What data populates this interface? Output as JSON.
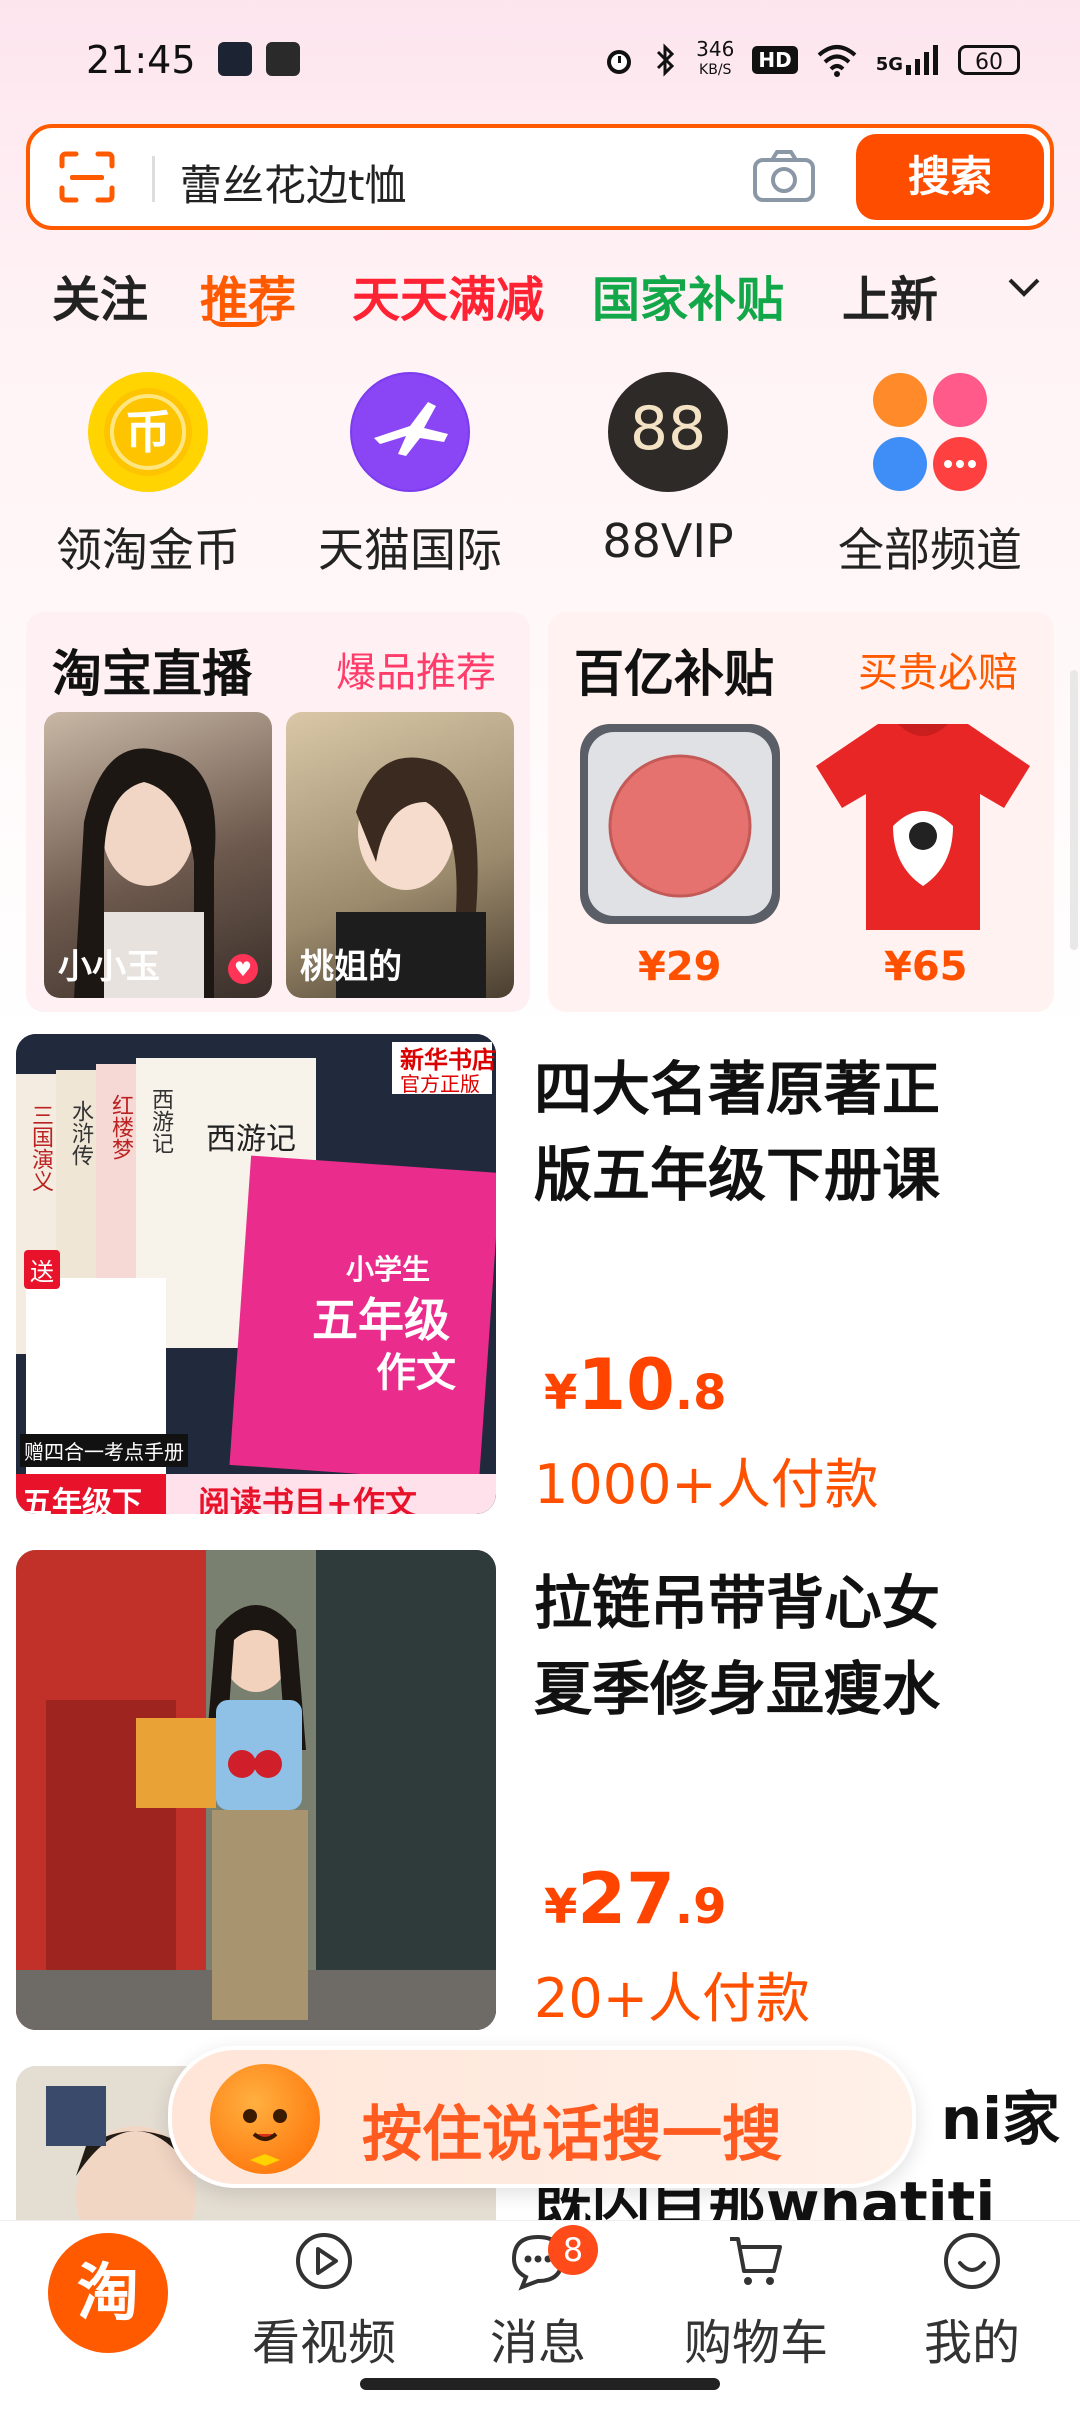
{
  "status_bar": {
    "time": "21:45",
    "net_speed_top": "346",
    "net_speed_bottom": "KB/S",
    "hd": "HD",
    "signal": "5G",
    "battery": "60"
  },
  "search": {
    "query": "蕾丝花边t恤",
    "button": "搜索"
  },
  "tabs": [
    "关注",
    "推荐",
    "天天满减",
    "国家补贴",
    "上新"
  ],
  "channels": [
    {
      "label": "领淘金币",
      "icon": "coin-icon"
    },
    {
      "label": "天猫国际",
      "icon": "plane-globe-icon"
    },
    {
      "label": "88VIP",
      "icon_text": "88",
      "icon": "vip-icon"
    },
    {
      "label": "全部频道",
      "icon": "channels-grid-icon"
    }
  ],
  "live_card": {
    "title": "淘宝直播",
    "subtitle": "爆品推荐",
    "streams": [
      {
        "name": "小小玉"
      },
      {
        "name": "桃姐的"
      }
    ]
  },
  "subsidy_card": {
    "title": "百亿补贴",
    "subtitle": "买贵必赔",
    "items": [
      {
        "price": "¥29"
      },
      {
        "price": "¥65"
      }
    ]
  },
  "products": [
    {
      "title_line1": "四大名著原著正",
      "title_line2": "版五年级下册课",
      "price_symbol": "¥",
      "price_int": "10",
      "price_dec": ".8",
      "sales": "1000+人付款",
      "image_text": {
        "book1": "三国演义",
        "book2": "水浒传",
        "book3": "红楼梦",
        "book4": "西游记",
        "cover_title": "西游记",
        "stamp": "新华书店",
        "stamp_sub": "官方正版",
        "pink_line1": "小学生",
        "pink_line2": "五年级",
        "pink_line3": "作文",
        "gift": "送",
        "gift_banner": "赠四合一考点手册",
        "grade_tag": "五年级下",
        "bottom_banner": "阅读书目+作文"
      }
    },
    {
      "title_line1": "拉链吊带背心女",
      "title_line2": "夏季修身显瘦水",
      "price_symbol": "¥",
      "price_int": "27",
      "price_dec": ".9",
      "sales": "20+人付款"
    },
    {
      "title_line1": "ni家",
      "title_line2": "既囚目那whatiti"
    }
  ],
  "voice_search": {
    "label": "按住说话搜一搜"
  },
  "bottom_nav": {
    "home": "淘",
    "items": [
      {
        "label": "看视频",
        "icon": "play-icon"
      },
      {
        "label": "消息",
        "icon": "message-icon",
        "badge": "8"
      },
      {
        "label": "购物车",
        "icon": "cart-icon"
      },
      {
        "label": "我的",
        "icon": "smile-icon"
      }
    ]
  },
  "colors": {
    "accent": "#ff5000",
    "red_tab": "#ff2233",
    "green_tab": "#12a84a",
    "pink": "#ff3c6a"
  }
}
